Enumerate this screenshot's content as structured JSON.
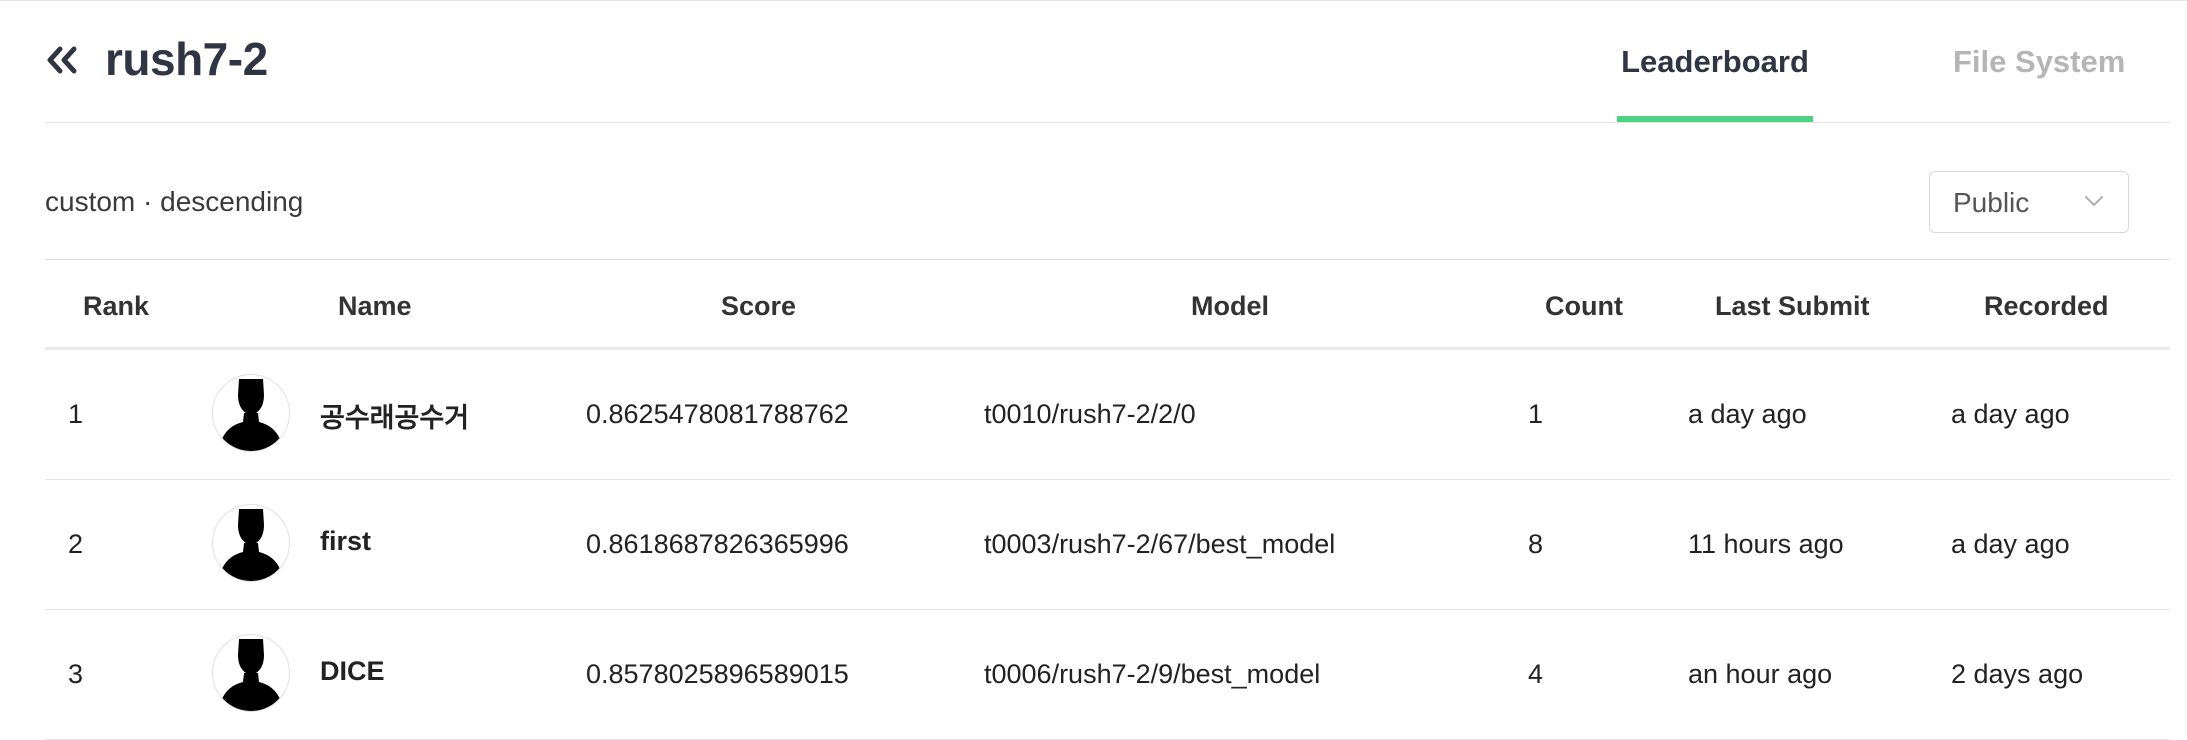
{
  "header": {
    "title": "rush7-2",
    "back_icon": "double-chevron-left-icon",
    "tabs": [
      {
        "label": "Leaderboard",
        "active": true
      },
      {
        "label": "File System",
        "active": false
      }
    ],
    "accent_color": "#4cd282"
  },
  "meta": {
    "text": "custom · descending"
  },
  "visibility_select": {
    "value": "Public",
    "icon": "chevron-down-icon"
  },
  "table": {
    "columns": [
      "Rank",
      "Name",
      "Score",
      "Model",
      "Count",
      "Last Submit",
      "Recorded"
    ],
    "rows": [
      {
        "rank": "1",
        "name": "공수래공수거",
        "score": "0.8625478081788762",
        "model": "t0010/rush7-2/2/0",
        "count": "1",
        "last_submit": "a day ago",
        "recorded": "a day ago"
      },
      {
        "rank": "2",
        "name": "first",
        "score": "0.8618687826365996",
        "model": "t0003/rush7-2/67/best_model",
        "count": "8",
        "last_submit": "11 hours ago",
        "recorded": "a day ago"
      },
      {
        "rank": "3",
        "name": "DICE",
        "score": "0.8578025896589015",
        "model": "t0006/rush7-2/9/best_model",
        "count": "4",
        "last_submit": "an hour ago",
        "recorded": "2 days ago"
      }
    ]
  }
}
